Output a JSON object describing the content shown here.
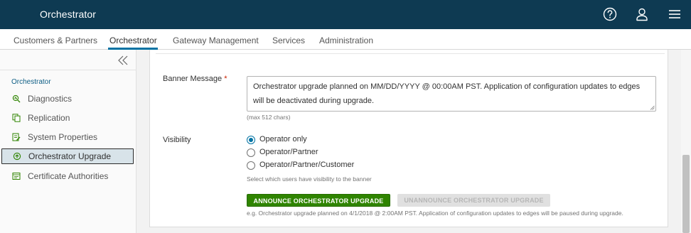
{
  "header": {
    "title": "Orchestrator",
    "icons": {
      "help": "help-icon",
      "user": "user-icon",
      "menu": "hamburger-menu-icon"
    }
  },
  "nav": {
    "tabs": [
      {
        "label": "Customers & Partners"
      },
      {
        "label": "Orchestrator"
      },
      {
        "label": "Gateway Management"
      },
      {
        "label": "Services"
      },
      {
        "label": "Administration"
      }
    ],
    "active_index": 1
  },
  "sidebar": {
    "section": "Orchestrator",
    "items": [
      {
        "label": "Diagnostics",
        "icon": "diagnostics-icon"
      },
      {
        "label": "Replication",
        "icon": "replication-icon"
      },
      {
        "label": "System Properties",
        "icon": "system-properties-icon"
      },
      {
        "label": "Orchestrator Upgrade",
        "icon": "upgrade-icon",
        "active": true
      },
      {
        "label": "Certificate Authorities",
        "icon": "certificate-icon"
      }
    ]
  },
  "form": {
    "banner_label": "Banner Message",
    "required_mark": "*",
    "banner_value": "Orchestrator upgrade planned on MM/DD/YYYY @ 00:00AM PST. Application of configuration updates to edges will be deactivated during upgrade.",
    "max_chars_hint": "(max 512 chars)",
    "visibility_label": "Visibility",
    "visibility_options": [
      {
        "label": "Operator only",
        "checked": true
      },
      {
        "label": "Operator/Partner",
        "checked": false
      },
      {
        "label": "Operator/Partner/Customer",
        "checked": false
      }
    ],
    "visibility_hint": "Select which users have visibility to the banner",
    "announce_button": "ANNOUNCE ORCHESTRATOR UPGRADE",
    "unannounce_button": "UNANNOUNCE ORCHESTRATOR UPGRADE",
    "example_text": "e.g. Orchestrator upgrade planned on 4/1/2018 @ 2:00AM PST. Application of configuration updates to edges will be paused during upgrade."
  },
  "colors": {
    "header_bg": "#0e3a52",
    "accent": "#0072a3",
    "primary_button": "#2f8400",
    "active_sidebar_bg": "#d8e3e9"
  }
}
